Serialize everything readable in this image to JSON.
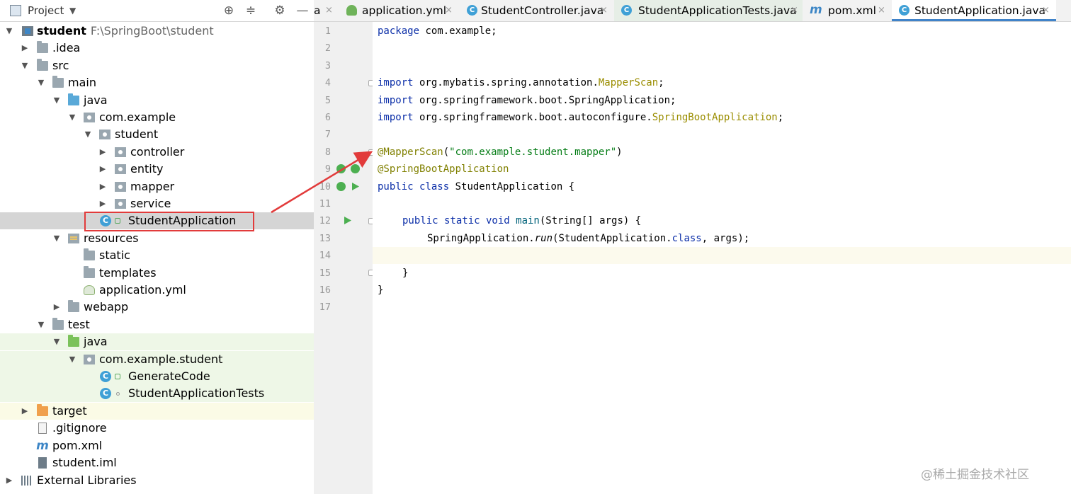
{
  "project_panel": {
    "title": "Project",
    "dropdown_icon": "chevron-down-icon",
    "toolbar_icons": [
      "locate-icon",
      "collapse-icon",
      "gear-icon",
      "minimize-icon"
    ]
  },
  "tree": [
    {
      "label": "student",
      "path": "F:\\SpringBoot\\student",
      "icon": "module-icon"
    },
    {
      "label": ".idea",
      "icon": "folder-icon"
    },
    {
      "label": "src",
      "icon": "folder-icon"
    },
    {
      "label": "main",
      "icon": "folder-icon"
    },
    {
      "label": "java",
      "icon": "source-folder-icon"
    },
    {
      "label": "com.example",
      "icon": "package-icon"
    },
    {
      "label": "student",
      "icon": "package-icon"
    },
    {
      "label": "controller",
      "icon": "package-icon"
    },
    {
      "label": "entity",
      "icon": "package-icon"
    },
    {
      "label": "mapper",
      "icon": "package-icon"
    },
    {
      "label": "service",
      "icon": "package-icon"
    },
    {
      "label": "StudentApplication",
      "icon": "spring-boot-class-icon"
    },
    {
      "label": "resources",
      "icon": "resources-folder-icon"
    },
    {
      "label": "static",
      "icon": "folder-icon"
    },
    {
      "label": "templates",
      "icon": "folder-icon"
    },
    {
      "label": "application.yml",
      "icon": "yml-file-icon"
    },
    {
      "label": "webapp",
      "icon": "folder-icon"
    },
    {
      "label": "test",
      "icon": "folder-icon"
    },
    {
      "label": "java",
      "icon": "test-source-folder-icon"
    },
    {
      "label": "com.example.student",
      "icon": "package-icon"
    },
    {
      "label": "GenerateCode",
      "icon": "class-icon"
    },
    {
      "label": "StudentApplicationTests",
      "icon": "test-class-icon"
    },
    {
      "label": "target",
      "icon": "excluded-folder-icon"
    },
    {
      "label": ".gitignore",
      "icon": "file-icon"
    },
    {
      "label": "pom.xml",
      "icon": "maven-icon"
    },
    {
      "label": "student.iml",
      "icon": "iml-file-icon"
    },
    {
      "label": "External Libraries",
      "icon": "libraries-icon"
    }
  ],
  "tabs": [
    {
      "label": "a",
      "icon": "",
      "close": "×"
    },
    {
      "label": "application.yml",
      "icon": "yml-file-icon",
      "close": "×"
    },
    {
      "label": "StudentController.java",
      "icon": "class-icon",
      "close": "×"
    },
    {
      "label": "StudentApplicationTests.java",
      "icon": "test-class-icon",
      "close": "×"
    },
    {
      "label": "pom.xml",
      "icon": "maven-icon",
      "close": "×"
    },
    {
      "label": "StudentApplication.java",
      "icon": "spring-boot-class-icon",
      "close": "×"
    }
  ],
  "line_numbers": [
    "1",
    "2",
    "3",
    "4",
    "5",
    "6",
    "7",
    "8",
    "9",
    "10",
    "11",
    "12",
    "13",
    "14",
    "15",
    "16",
    "17"
  ],
  "code": {
    "l1_kw": "package",
    "l1_rest": " com.example;",
    "l4_kw": "import",
    "l4_pkg": " org.mybatis.spring.annotation.",
    "l4_cls": "MapperScan",
    "l4_end": ";",
    "l5_kw": "import",
    "l5_pkg": " org.springframework.boot.SpringApplication;",
    "l6_kw": "import",
    "l6_pkg": " org.springframework.boot.autoconfigure.",
    "l6_cls": "SpringBootApplication",
    "l6_end": ";",
    "l8_ann": "@MapperScan",
    "l8_open": "(",
    "l8_str": "\"com.example.student.mapper\"",
    "l8_close": ")",
    "l9_ann": "@SpringBootApplication",
    "l10_kw": "public class",
    "l10_rest": " StudentApplication {",
    "l12_kw": "public static void",
    "l12_meth": " main",
    "l12_rest": "(String[] args) {",
    "l13_a": "SpringApplication.",
    "l13_run": "run",
    "l13_b": "(StudentApplication.",
    "l13_cls": "class",
    "l13_c": ", args);",
    "l15": "}",
    "l16": "}"
  },
  "watermark": "@稀土掘金技术社区",
  "colors": {
    "keyword": "#0b2ea8",
    "annotation": "#808000",
    "string": "#067d17",
    "highlight_box": "#e23b3b",
    "active_tab_underline": "#4083c9"
  }
}
